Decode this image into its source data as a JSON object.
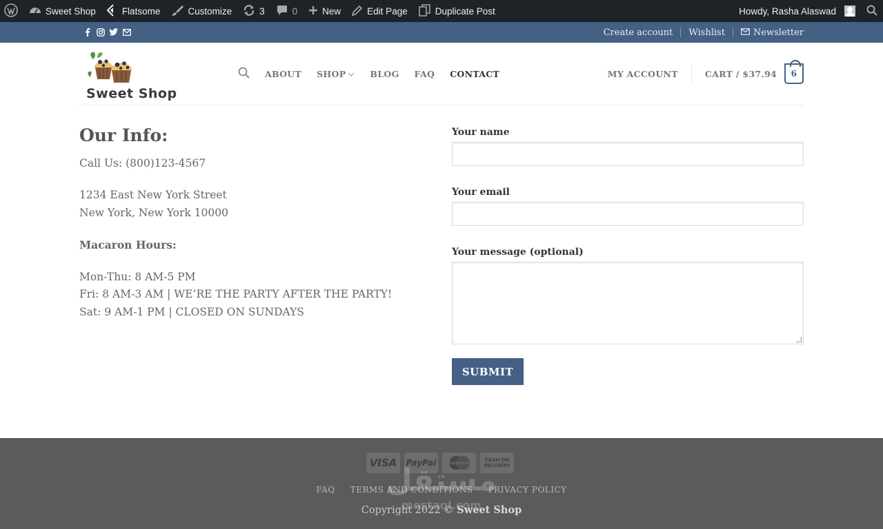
{
  "admin_bar": {
    "site_name": "Sweet Shop",
    "theme": "Flatsome",
    "customize": "Customize",
    "updates_count": "3",
    "comments_count": "0",
    "new": "New",
    "edit_page": "Edit Page",
    "duplicate_post": "Duplicate Post",
    "howdy": "Howdy, Rasha Alaswad"
  },
  "top_bar": {
    "create_account": "Create account",
    "wishlist": "Wishlist",
    "newsletter": "Newsletter"
  },
  "header": {
    "logo_text": "Sweet Shop",
    "nav": [
      "ABOUT",
      "SHOP",
      "BLOG",
      "FAQ",
      "CONTACT"
    ],
    "my_account": "MY ACCOUNT",
    "cart_label": "CART /",
    "cart_amount": "$37.94",
    "cart_count": "6"
  },
  "info": {
    "title": "Our Info:",
    "phone": "Call Us: (800)123-4567",
    "address_line1": "1234 East New York Street",
    "address_line2": "New York, New York 10000",
    "hours_title": "Macaron Hours:",
    "hours": [
      "Mon-Thu: 8 AM-5 PM",
      "Fri: 8 AM-3 AM  | WE’RE THE PARTY AFTER THE PARTY!",
      "Sat: 9 AM-1 PM | CLOSED ON SUNDAYS"
    ]
  },
  "form": {
    "name_label": "Your name",
    "email_label": "Your email",
    "message_label": "Your message (optional)",
    "submit": "SUBMIT"
  },
  "footer": {
    "payments": [
      "VISA",
      "PayPal",
      "MasterCard",
      "CASH ON DELIVERY"
    ],
    "links": [
      "FAQ",
      "TERMS AND CONDITIONS",
      "PRIVACY POLICY"
    ],
    "copyright_prefix": "Copyright 2022 ©",
    "copyright_brand": "Sweet Shop",
    "watermark_ar": "مستقل",
    "watermark_lat": "mostaql.com"
  },
  "colors": {
    "admin_bar": "#1d2327",
    "primary": "#446084",
    "footer": "#5b5b5b"
  }
}
